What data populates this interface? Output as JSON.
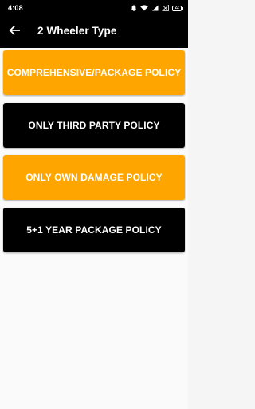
{
  "status_bar": {
    "time": "4:08",
    "battery_level": "22",
    "icons": [
      "notification-icon",
      "wifi-icon",
      "signal-icon",
      "signal-icon",
      "battery-icon"
    ]
  },
  "app_bar": {
    "back_icon": "arrow-back-icon",
    "title": "2 Wheeler Type"
  },
  "options": [
    {
      "label": "COMPREHENSIVE/PACKAGE POLICY",
      "color": "#ffa500"
    },
    {
      "label": "ONLY THIRD PARTY POLICY",
      "color": "#000000"
    },
    {
      "label": "ONLY OWN DAMAGE POLICY",
      "color": "#ffa500"
    },
    {
      "label": "5+1 YEAR PACKAGE POLICY",
      "color": "#000000"
    }
  ]
}
